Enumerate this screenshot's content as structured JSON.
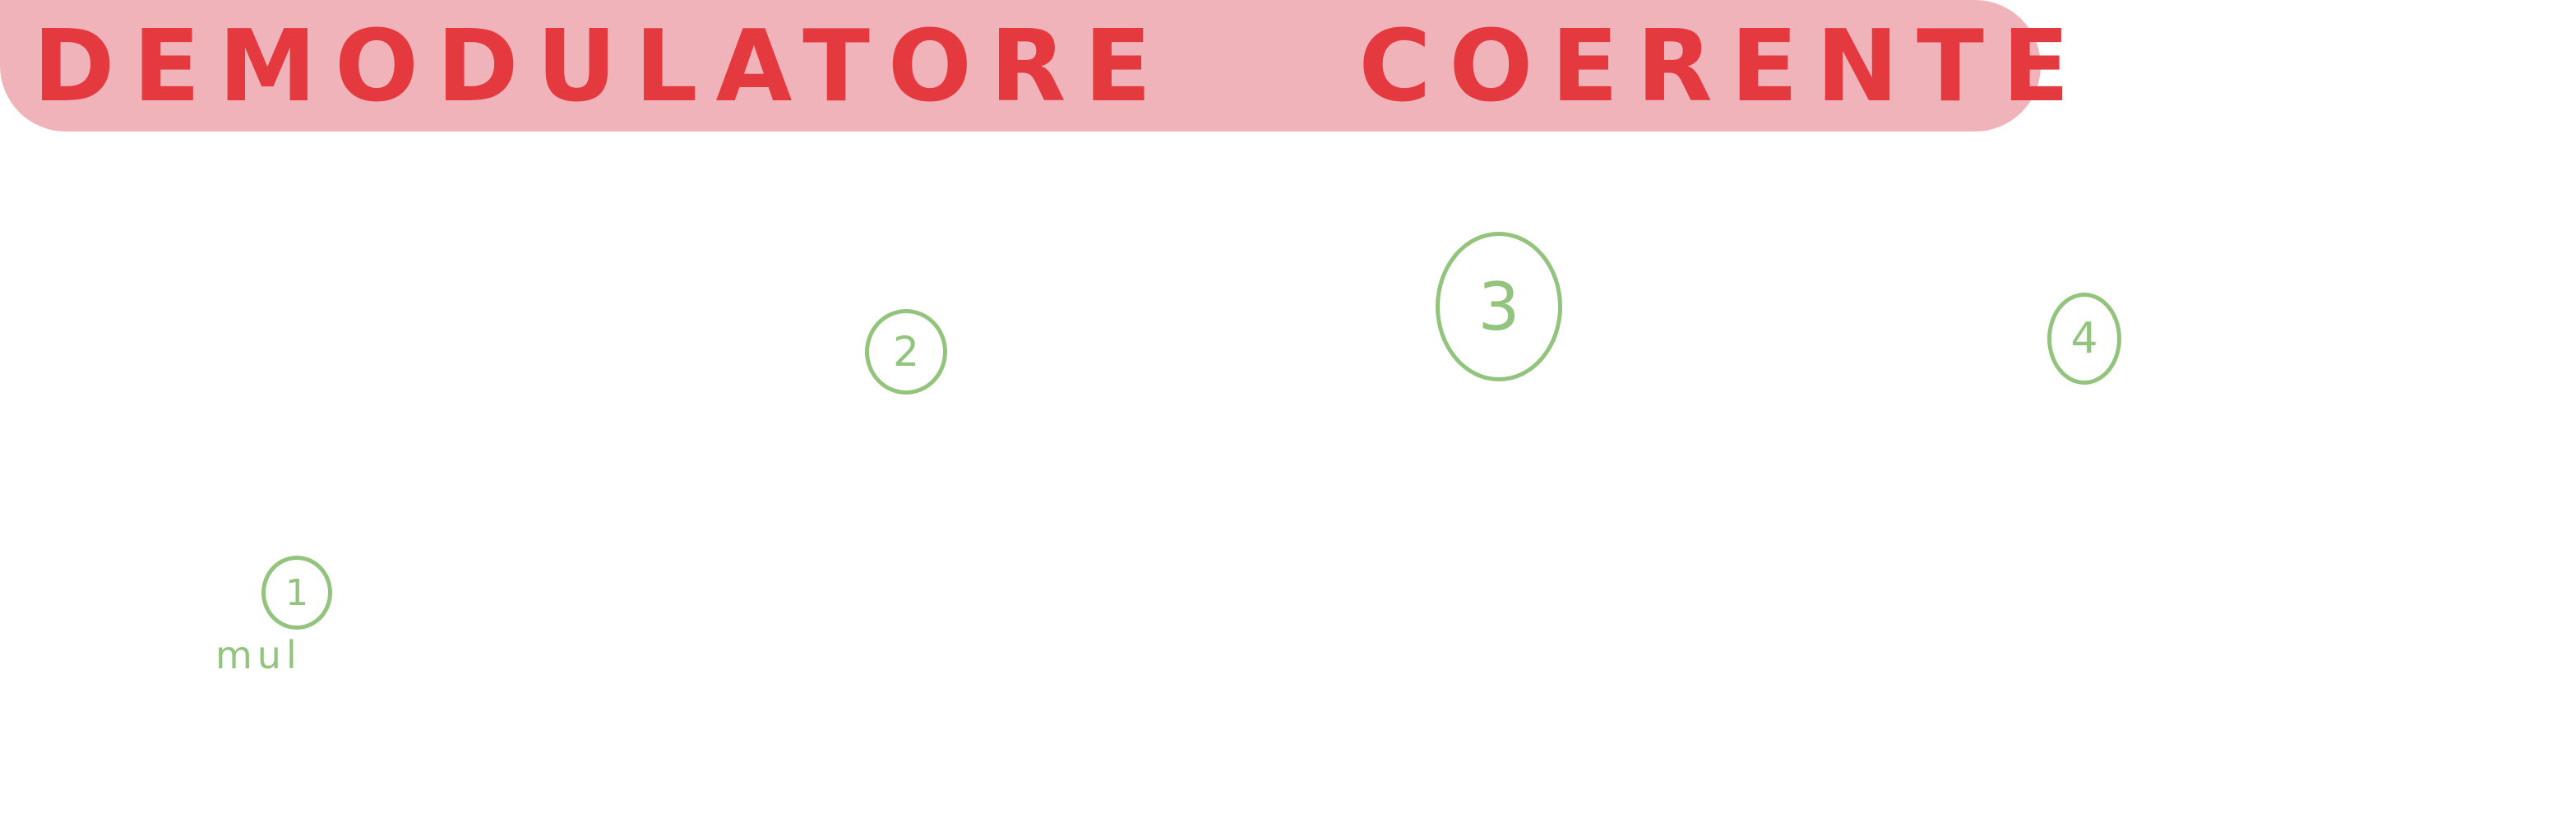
{
  "title": {
    "word1": "DEMODULATORE",
    "word2": "COERENTE"
  },
  "markers": [
    {
      "label": "1"
    },
    {
      "label": "2"
    },
    {
      "label": "3"
    },
    {
      "label": "4"
    }
  ],
  "note": "mul",
  "colors": {
    "banner_background": "#f0b3ba",
    "title_text": "#e53940",
    "marker": "#93c47d"
  }
}
